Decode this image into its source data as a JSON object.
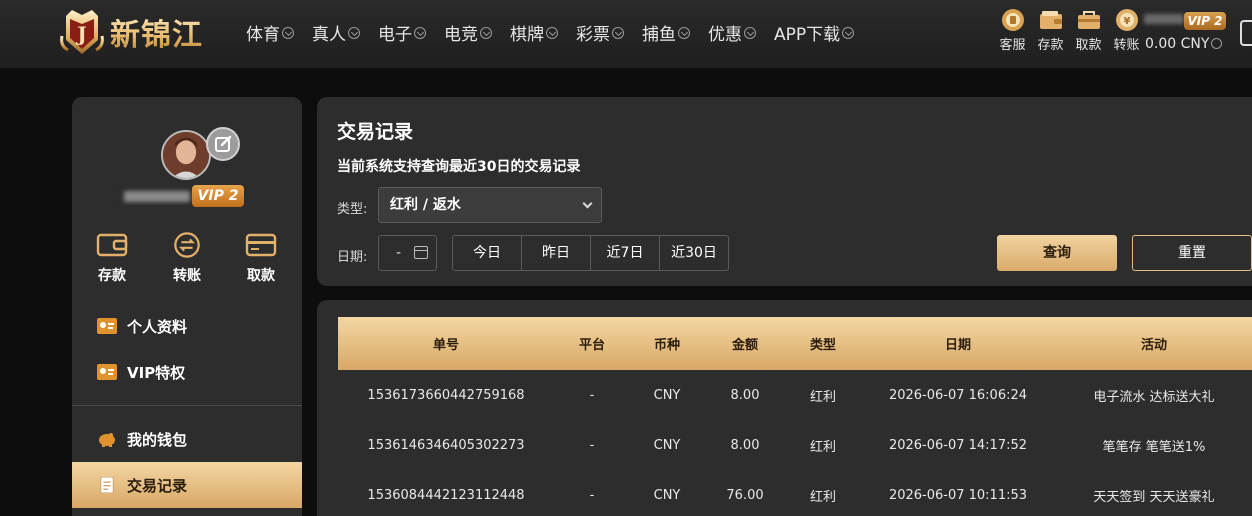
{
  "header": {
    "logo_text": "新锦江",
    "nav": [
      "体育",
      "真人",
      "电子",
      "电竞",
      "棋牌",
      "彩票",
      "捕鱼",
      "优惠",
      "APP下载"
    ],
    "actions": [
      {
        "label": "客服",
        "icon": "customer-service-icon"
      },
      {
        "label": "存款",
        "icon": "wallet-icon"
      },
      {
        "label": "取款",
        "icon": "withdraw-bag-icon"
      },
      {
        "label": "转账",
        "icon": "transfer-coin-icon"
      }
    ],
    "vip": "VIP 2",
    "balance": "0.00 CNY"
  },
  "sidebar": {
    "vip": "VIP 2",
    "quick": [
      {
        "label": "存款",
        "icon": "wallet-icon"
      },
      {
        "label": "转账",
        "icon": "transfer-icon"
      },
      {
        "label": "取款",
        "icon": "card-icon"
      }
    ],
    "menu": [
      {
        "label": "个人资料",
        "icon": "profile-card-icon"
      },
      {
        "label": "VIP特权",
        "icon": "vip-card-icon"
      },
      {
        "label": "我的钱包",
        "icon": "piggy-bank-icon"
      },
      {
        "label": "交易记录",
        "icon": "document-icon",
        "active": true
      }
    ]
  },
  "records": {
    "title": "交易记录",
    "subtitle": "当前系统支持查询最近30日的交易记录",
    "type_label": "类型:",
    "type_value": "红利 / 返水",
    "date_label": "日期:",
    "date_value": "-",
    "ranges": [
      "今日",
      "昨日",
      "近7日",
      "近30日"
    ],
    "query_label": "查询",
    "reset_label": "重置"
  },
  "table": {
    "columns": [
      "单号",
      "平台",
      "币种",
      "金额",
      "类型",
      "日期",
      "活动"
    ],
    "rows": [
      [
        "1536173660442759168",
        "-",
        "CNY",
        "8.00",
        "红利",
        "2026-06-07 16:06:24",
        "电子流水 达标送大礼"
      ],
      [
        "1536146346405302273",
        "-",
        "CNY",
        "8.00",
        "红利",
        "2026-06-07 14:17:52",
        "笔笔存 笔笔送1%"
      ],
      [
        "1536084442123112448",
        "-",
        "CNY",
        "76.00",
        "红利",
        "2026-06-07 10:11:53",
        "天天签到 天天送豪礼"
      ]
    ]
  },
  "colors": {
    "gold_light": "#f3d6a3",
    "gold_dark": "#d8a866",
    "panel_bg": "#2d2d2d",
    "vip_orange": "#e9a34a"
  }
}
